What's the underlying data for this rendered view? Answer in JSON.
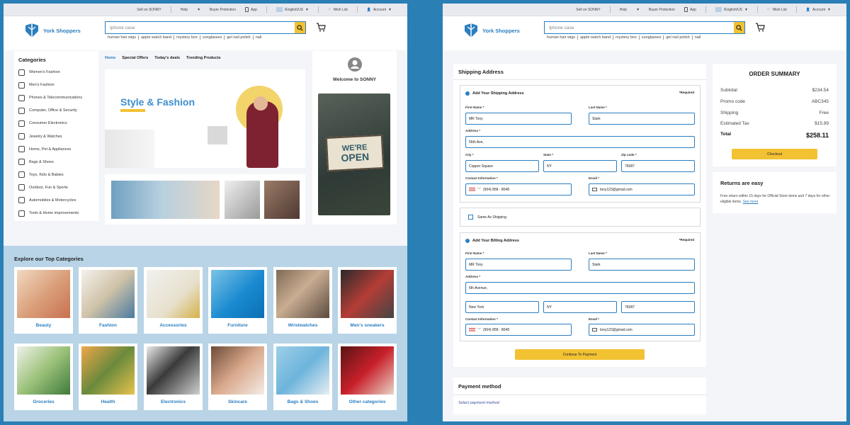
{
  "topbar": {
    "sell": "Sell on SONNY",
    "help": "Help",
    "buyer_protection": "Buyer Protection",
    "app": "App",
    "language": "/English/US",
    "wishlist": "Wish List",
    "account": "Account"
  },
  "header": {
    "brand": "York Shoppers",
    "search_value": "Iphone case",
    "tags": [
      "human hair wigs",
      "apple watch band",
      "mystery box",
      "sunglasses",
      "gel nail polish",
      "nail"
    ]
  },
  "categories": {
    "title": "Categories",
    "items": [
      {
        "label": "Women's Fashion",
        "icon": "dress-icon"
      },
      {
        "label": "Men's Fashion",
        "icon": "shirt-icon"
      },
      {
        "label": "Phones & Telecommunications",
        "icon": "phone-icon"
      },
      {
        "label": "Computer, Office & Security",
        "icon": "computer-icon"
      },
      {
        "label": "Consumer Electronics",
        "icon": "electronics-icon"
      },
      {
        "label": "Jewelry & Watches",
        "icon": "diamond-icon"
      },
      {
        "label": "Home, Pet & Appliances",
        "icon": "home-icon"
      },
      {
        "label": "Bags & Shoes",
        "icon": "bag-icon"
      },
      {
        "label": "Toys, Kids & Babies",
        "icon": "toy-icon"
      },
      {
        "label": "Outdoor, Fun & Sports",
        "icon": "ball-icon"
      },
      {
        "label": "Automobiles & Motorcycles",
        "icon": "car-icon"
      },
      {
        "label": "Tools & Home improvements",
        "icon": "tools-icon"
      }
    ]
  },
  "nav": {
    "home": "Home",
    "special": "Special Offers",
    "deals": "Today's deals",
    "trending": "Trending Products"
  },
  "hero": {
    "title": "Style & Fashion"
  },
  "welcome": {
    "text": "Welcome to SONNY",
    "sign_line1": "WE'RE",
    "sign_line2": "OPEN"
  },
  "explore": {
    "title": "Explore our Top Categories",
    "tiles": [
      {
        "label": "Beauty"
      },
      {
        "label": "Fashion"
      },
      {
        "label": "Accessories"
      },
      {
        "label": "Furniture"
      },
      {
        "label": "Wristwatches"
      },
      {
        "label": "Men's sneakers"
      },
      {
        "label": "Groceries"
      },
      {
        "label": "Health"
      },
      {
        "label": "Electronics"
      },
      {
        "label": "Skincare"
      },
      {
        "label": "Bags & Shoes"
      },
      {
        "label": "Other categories"
      }
    ]
  },
  "shipping": {
    "title": "Shipping Address",
    "required": "*Required",
    "ship_card_title": "Add Your Shipping Address",
    "bill_card_title": "Add Your Billing Address",
    "labels": {
      "first": "First Name *",
      "last": "Last Name *",
      "address": "Address *",
      "city": "City *",
      "state": "State *",
      "zip": "Zip code *",
      "contact": "Contact Information *",
      "email": "Email *"
    },
    "ship": {
      "first": "MR Tony",
      "last": "Stark",
      "address": "56th Ave,",
      "city": "Copper Square",
      "state": "NY",
      "zip": "76087",
      "phone": "(904) 858 - 8048",
      "email": "tony123@gmail.com"
    },
    "bill": {
      "first": "MR Tony",
      "last": "Stark",
      "address": "6th Avenue,",
      "city": "New York",
      "state": "NY",
      "zip": "76087",
      "phone": "(904) 858 - 8048",
      "email": "tony123@gmail.com"
    },
    "same_as": "Same As Shipping",
    "continue": "Continue To Payment"
  },
  "payment": {
    "title": "Payment method",
    "select": "Select payment method"
  },
  "summary": {
    "title": "ORDER SUMMARY",
    "subtotal_label": "Subtotal",
    "subtotal": "$234.54",
    "promo_label": "Promo code",
    "promo": "ABC345",
    "shipping_label": "Shipping",
    "shipping": "Free",
    "tax_label": "Estimated Tax",
    "tax": "$15.99",
    "total_label": "Total",
    "total": "$258.11",
    "checkout": "Checkout"
  },
  "returns": {
    "title": "Returns are easy",
    "text": "Free return within 15 days for Official Store items and 7 days for other eligible items.",
    "link": "See more"
  },
  "colors": {
    "accent": "#2b7ec0",
    "cta": "#f2c233",
    "page_bg": "#2a7fb5"
  }
}
